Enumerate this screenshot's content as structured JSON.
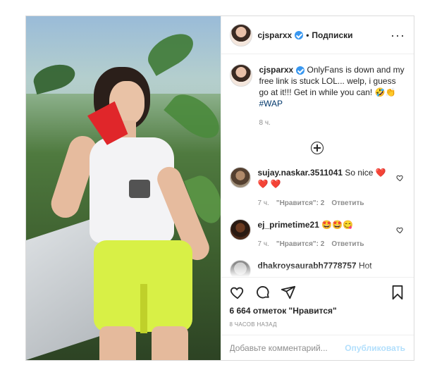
{
  "post": {
    "author": {
      "username": "cjsparxx",
      "follow_label": "Подписки",
      "more_icon": "more-horizontal-icon"
    },
    "caption": {
      "username": "cjsparxx",
      "text": "OnlyFans is down and my free link is stuck LOL... welp, i guess go at it!!! Get in while you can! 🤣👏",
      "hashtag": "#WAP",
      "time": "8 ч."
    },
    "load_more_icon": "plus-circle-icon",
    "comments": [
      {
        "username": "sujay.naskar.3511041",
        "text": "So nice ❤️ ❤️ ❤️",
        "time": "7 ч.",
        "likes": "\"Нравится\": 2",
        "reply": "Ответить"
      },
      {
        "username": "ej_primetime21",
        "text": "🤩🤩😋",
        "time": "7 ч.",
        "likes": "\"Нравится\": 2",
        "reply": "Ответить"
      },
      {
        "username": "dhakroysaurabh7778757",
        "text": "Hot",
        "time": "",
        "likes": "",
        "reply": ""
      }
    ],
    "actions": {
      "like_icon": "heart-icon",
      "comment_icon": "comment-icon",
      "share_icon": "share-icon",
      "save_icon": "bookmark-icon"
    },
    "likes_text": "6 664 отметок \"Нравится\"",
    "posted_ago": "8 ЧАСОВ НАЗАД",
    "add_comment": {
      "placeholder": "Добавьте комментарий...",
      "publish_label": "Опубликовать"
    }
  },
  "colors": {
    "link": "#00376b",
    "verified": "#3897f0",
    "publish_disabled": "#b2dffc",
    "secondary_text": "#8e8e8e"
  }
}
